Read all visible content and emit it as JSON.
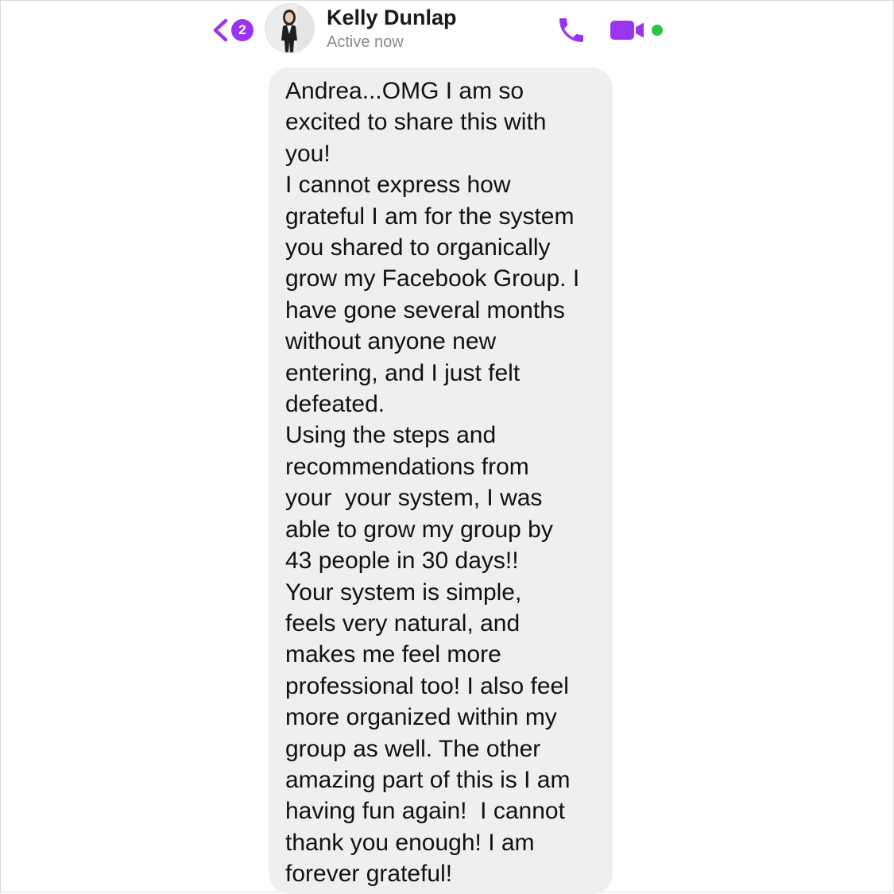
{
  "header": {
    "unread_count": "2",
    "contact_name": "Kelly Dunlap",
    "contact_status": "Active now",
    "icons": {
      "back": "chevron-left-icon",
      "call": "phone-icon",
      "video": "video-camera-icon",
      "online": "online-dot-icon"
    },
    "accent_color": "#9b34f2",
    "online_color": "#2ec44a"
  },
  "message": {
    "bubble_color": "#efefef",
    "lines": [
      "Andrea...OMG I am so",
      "excited to share this with",
      "you!",
      "I cannot express how",
      "grateful I am for the system",
      "you shared to organically",
      "grow my Facebook Group. I",
      "have gone several months",
      "without anyone new",
      "entering, and I just felt",
      "defeated.",
      "Using the steps and",
      "recommendations from",
      "your  your system, I was",
      "able to grow my group by",
      "43 people in 30 days!!",
      "Your system is simple,",
      "feels very natural, and",
      "makes me feel more",
      "professional too! I also feel",
      "more organized within my",
      "group as well. The other",
      "amazing part of this is I am",
      "having fun again!  I cannot",
      "thank you enough! I am",
      "forever grateful!"
    ]
  }
}
